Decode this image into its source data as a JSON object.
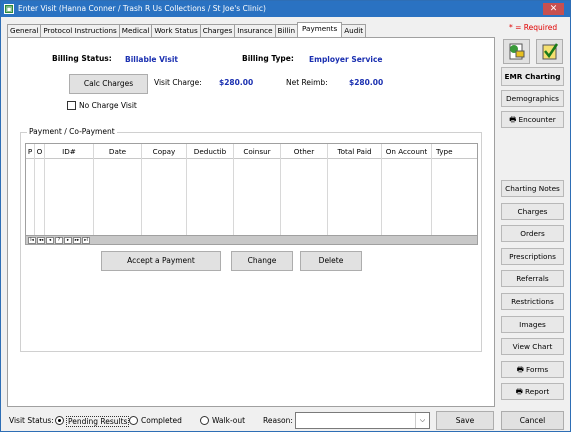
{
  "window": {
    "title": "Enter Visit (Hanna Conner / Trash R Us Collections / St Joe's Clinic)",
    "close_glyph": "✕",
    "app_glyph": "▣"
  },
  "tabs": [
    {
      "label": "General"
    },
    {
      "label": "Protocol Instructions"
    },
    {
      "label": "Medical"
    },
    {
      "label": "Work Status"
    },
    {
      "label": "Charges"
    },
    {
      "label": "Insurance"
    },
    {
      "label": "Billin"
    },
    {
      "label": "Payments"
    },
    {
      "label": "Audit"
    }
  ],
  "required_note": "* = Required",
  "billing": {
    "status_label": "Billing Status:",
    "status_value": "Billable Visit",
    "type_label": "Billing Type:",
    "type_value": "Employer Service",
    "calc_button": "Calc Charges",
    "visit_charge_label": "Visit Charge:",
    "visit_charge_value": "$280.00",
    "net_reimb_label": "Net Reimb:",
    "net_reimb_value": "$280.00",
    "no_charge_label": "No Charge Visit"
  },
  "payments": {
    "group_title": "Payment / Co-Payment",
    "columns": [
      "P",
      "O",
      "ID#",
      "Date",
      "Copay",
      "Deductib",
      "Coinsur",
      "Other",
      "Total Paid",
      "On Account",
      "Type"
    ],
    "nav_glyphs": [
      "I◂",
      "◂◂",
      "◂",
      "?",
      "▸",
      "▸▸",
      "▸I"
    ],
    "accept_button": "Accept a Payment",
    "change_button": "Change",
    "delete_button": "Delete"
  },
  "sidebar": {
    "emr_charting": "EMR Charting",
    "demographics": "Demographics",
    "encounter": "Encounter",
    "charting_notes": "Charting Notes",
    "charges": "Charges",
    "orders": "Orders",
    "prescriptions": "Prescriptions",
    "referrals": "Referrals",
    "restrictions": "Restrictions",
    "images": "Images",
    "view_chart": "View Chart",
    "forms": "Forms",
    "report": "Report"
  },
  "footer": {
    "visit_status_label": "Visit Status:",
    "pending": "Pending Results",
    "completed": "Completed",
    "walkout": "Walk-out",
    "reason_label": "Reason:",
    "reason_value": "",
    "save": "Save",
    "cancel": "Cancel"
  },
  "colors": {
    "titlebar": "#2a72c2",
    "required": "#e00000",
    "value_blue": "#1a2fb0"
  }
}
